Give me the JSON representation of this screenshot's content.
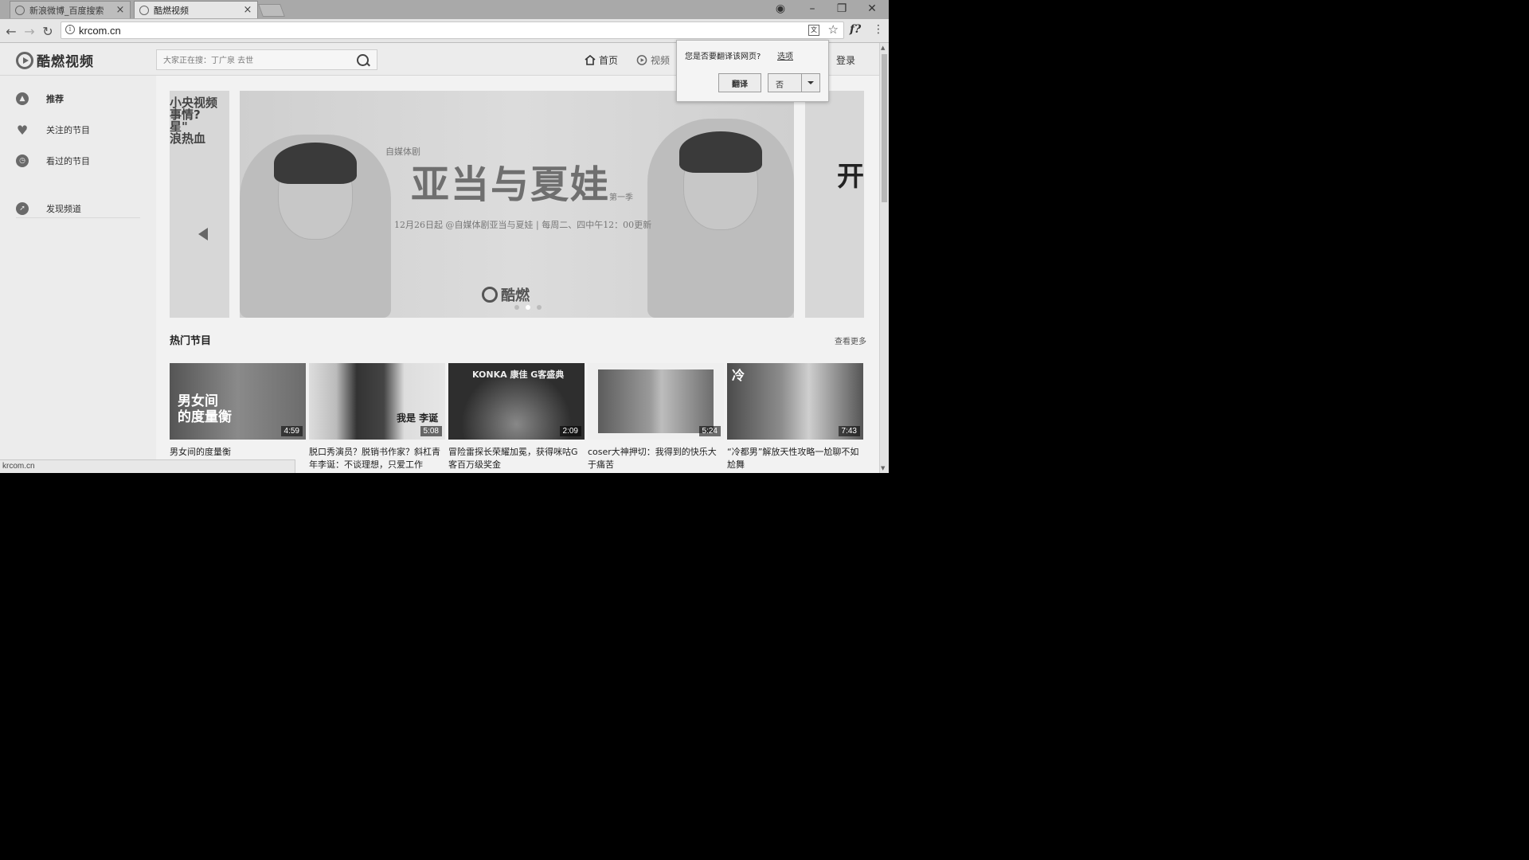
{
  "browser": {
    "tabs": [
      {
        "label": "新浪微博_百度搜索",
        "active": false
      },
      {
        "label": "酷燃视频",
        "active": true
      }
    ],
    "url": "krcom.cn",
    "status_url": "krcom.cn"
  },
  "translate_popup": {
    "question": "您是否要翻译该网页?",
    "options_link": "选项",
    "translate_button": "翻译",
    "no_button": "否"
  },
  "site": {
    "logo_text": "酷燃视频",
    "search_placeholder": "大家正在搜：丁广泉 去世",
    "nav": [
      {
        "label": "首页",
        "icon": "home-icon"
      },
      {
        "label": "视频",
        "icon": "play-icon"
      }
    ],
    "login": "登录"
  },
  "sidebar": {
    "items": [
      {
        "label": "推荐",
        "icon": "flame-icon",
        "active": true
      },
      {
        "label": "关注的节目",
        "icon": "heart-icon",
        "active": false
      },
      {
        "label": "看过的节目",
        "icon": "clock-icon",
        "active": false
      },
      {
        "label": "发现频道",
        "icon": "compass-icon",
        "active": false
      }
    ]
  },
  "banner": {
    "left_text": "小央视频\n事情?\n星\"\n浪热血",
    "subtitle": "自媒体剧",
    "title": "亚当与夏娃",
    "season": "第一季",
    "schedule": "12月26日起 @自媒体剧亚当与夏娃 | 每周二、四中午12：00更新",
    "brand": "酷燃",
    "right_text": "开"
  },
  "hot": {
    "title": "热门节目",
    "more": "查看更多",
    "cards": [
      {
        "title": "男女间的度量衡",
        "duration": "4:59",
        "overlay": "男女间\n的度量衡"
      },
      {
        "title": "脱口秀演员？脱销书作家？斜杠青年李诞：不谈理想，只爱工作",
        "duration": "5:08",
        "overlay": "我是 李诞"
      },
      {
        "title": "冒险雷探长荣耀加冕，获得咪咕G客百万级奖金",
        "duration": "2:09",
        "overlay": "KONKA 康佳 G客盛典"
      },
      {
        "title": "coser大神押切：我得到的快乐大于痛苦",
        "duration": "5:24",
        "overlay": ""
      },
      {
        "title": "“冷都男”解放天性攻略一尬聊不如尬舞",
        "duration": "7:43",
        "overlay": "冷"
      }
    ]
  }
}
